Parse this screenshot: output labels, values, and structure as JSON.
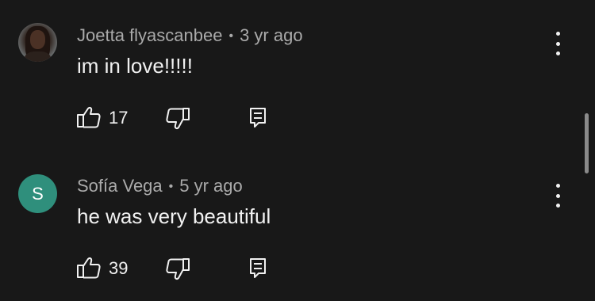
{
  "comments": [
    {
      "author": "Joetta flyascanbee",
      "separator": "•",
      "time": "3 yr ago",
      "text": "im in love!!!!!",
      "likes": "17",
      "avatar_type": "photo"
    },
    {
      "author": "Sofía Vega",
      "separator": "•",
      "time": "5 yr ago",
      "text": "he was very beautiful",
      "likes": "39",
      "avatar_type": "letter",
      "avatar_letter": "S",
      "avatar_color": "#2f8f7c"
    }
  ],
  "icons": {
    "like": "thumbs-up-icon",
    "dislike": "thumbs-down-icon",
    "reply": "reply-icon",
    "more": "more-vertical-icon"
  }
}
